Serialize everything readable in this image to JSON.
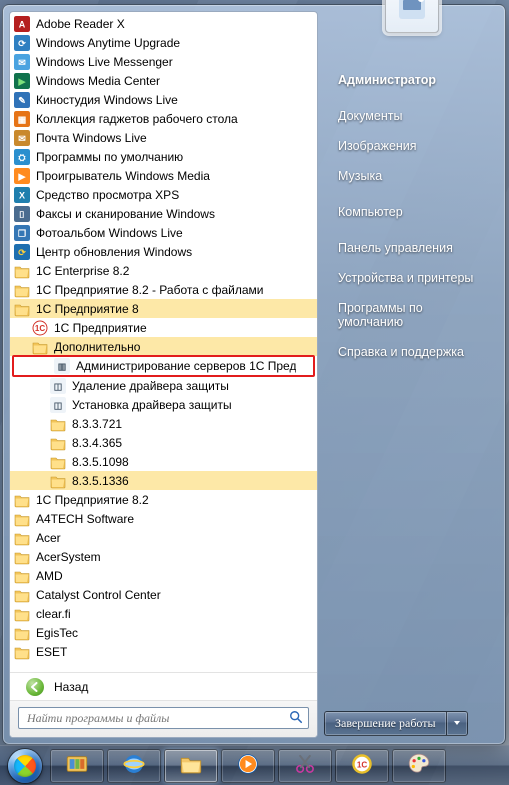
{
  "right": {
    "user": "Администратор",
    "links": [
      "Документы",
      "Изображения",
      "Музыка",
      "Компьютер",
      "Панель управления",
      "Устройства и принтеры",
      "Программы по умолчанию",
      "Справка и поддержка"
    ],
    "shutdown_label": "Завершение работы"
  },
  "back_label": "Назад",
  "search_placeholder": "Найти программы и файлы",
  "programs": {
    "top": [
      {
        "label": "Adobe Reader X",
        "icon": "adobe"
      },
      {
        "label": "Windows Anytime Upgrade",
        "icon": "anytime"
      },
      {
        "label": "Windows Live Messenger",
        "icon": "messenger"
      },
      {
        "label": "Windows Media Center",
        "icon": "mediacenter"
      },
      {
        "label": "Киностудия Windows Live",
        "icon": "moviemaker"
      },
      {
        "label": "Коллекция гаджетов рабочего стола",
        "icon": "gadgets"
      },
      {
        "label": "Почта Windows Live",
        "icon": "mail"
      },
      {
        "label": "Программы по умолчанию",
        "icon": "defaults"
      },
      {
        "label": "Проигрыватель Windows Media",
        "icon": "wmp"
      },
      {
        "label": "Средство просмотра XPS",
        "icon": "xps"
      },
      {
        "label": "Факсы и сканирование Windows",
        "icon": "fax"
      },
      {
        "label": "Фотоальбом Windows Live",
        "icon": "photo"
      },
      {
        "label": "Центр обновления Windows",
        "icon": "update"
      }
    ],
    "group1": [
      {
        "label": "1C Enterprise 8.2",
        "type": "folder"
      },
      {
        "label": "1С Предприятие 8.2 - Работа с файлами",
        "type": "folder"
      }
    ],
    "expanded_folder": "1С Предприятие 8",
    "expanded_children": {
      "exe": {
        "label": "1С Предприятие",
        "icon": "1c"
      },
      "sub_folder": "Дополнительно",
      "sub_items": [
        {
          "label": "Администрирование серверов 1С Пред",
          "icon": "mmc",
          "highlight": true
        },
        {
          "label": "Удаление драйвера защиты",
          "icon": "setup"
        },
        {
          "label": "Установка драйвера защиты",
          "icon": "setup"
        }
      ],
      "versions": [
        "8.3.3.721",
        "8.3.4.365",
        "8.3.5.1098",
        "8.3.5.1336"
      ]
    },
    "bottom_folders": [
      "1С Предприятие 8.2",
      "A4TECH Software",
      "Acer",
      "AcerSystem",
      "AMD",
      "Catalyst Control Center",
      "clear.fi",
      "EgisTec",
      "ESET"
    ]
  },
  "taskbar": {
    "buttons": [
      {
        "name": "libraries",
        "tone": "#f0c35a"
      },
      {
        "name": "ie",
        "tone": "#2a7fd4"
      },
      {
        "name": "explorer",
        "tone": "#f3c76a",
        "active": true
      },
      {
        "name": "wmp",
        "tone": "#ff8b1f"
      },
      {
        "name": "snip",
        "tone": "#c63aa0"
      },
      {
        "name": "1c",
        "tone": "#e8bf2a"
      },
      {
        "name": "paint",
        "tone": "#3aa0e6"
      }
    ]
  },
  "colors": {
    "highlight": "#e21c1c",
    "selection": "#fde8a7"
  }
}
